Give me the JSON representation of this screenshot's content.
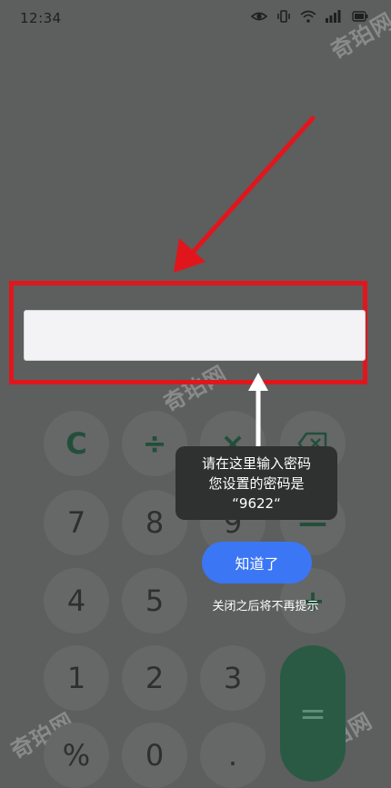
{
  "status_bar": {
    "time": "12:34",
    "icons": [
      "eye-icon",
      "vibrate-icon",
      "wifi-icon",
      "signal-icon",
      "battery-icon"
    ]
  },
  "watermark": {
    "text": "奇珀网"
  },
  "password_field": {
    "value": "",
    "placeholder": ""
  },
  "tooltip": {
    "line1": "请在这里输入密码",
    "line2": "您设置的密码是",
    "line3": "“9622“"
  },
  "got_it_button": {
    "label": "知道了"
  },
  "no_remind_text": "关闭之后将不再提示",
  "keypad": {
    "clear": "C",
    "divide": "÷",
    "multiply": "×",
    "backspace_icon": "backspace-icon",
    "seven": "7",
    "eight": "8",
    "nine": "9",
    "minus": "—",
    "four": "4",
    "five": "5",
    "plus": "+",
    "one": "1",
    "two": "2",
    "three": "3",
    "percent": "%",
    "zero": "0",
    "dot": ".",
    "equals": "="
  },
  "colors": {
    "highlight": "#e1161c",
    "arrow_red": "#e1161c",
    "button_blue": "#3b76f5",
    "equals_green": "#2a5a44"
  }
}
